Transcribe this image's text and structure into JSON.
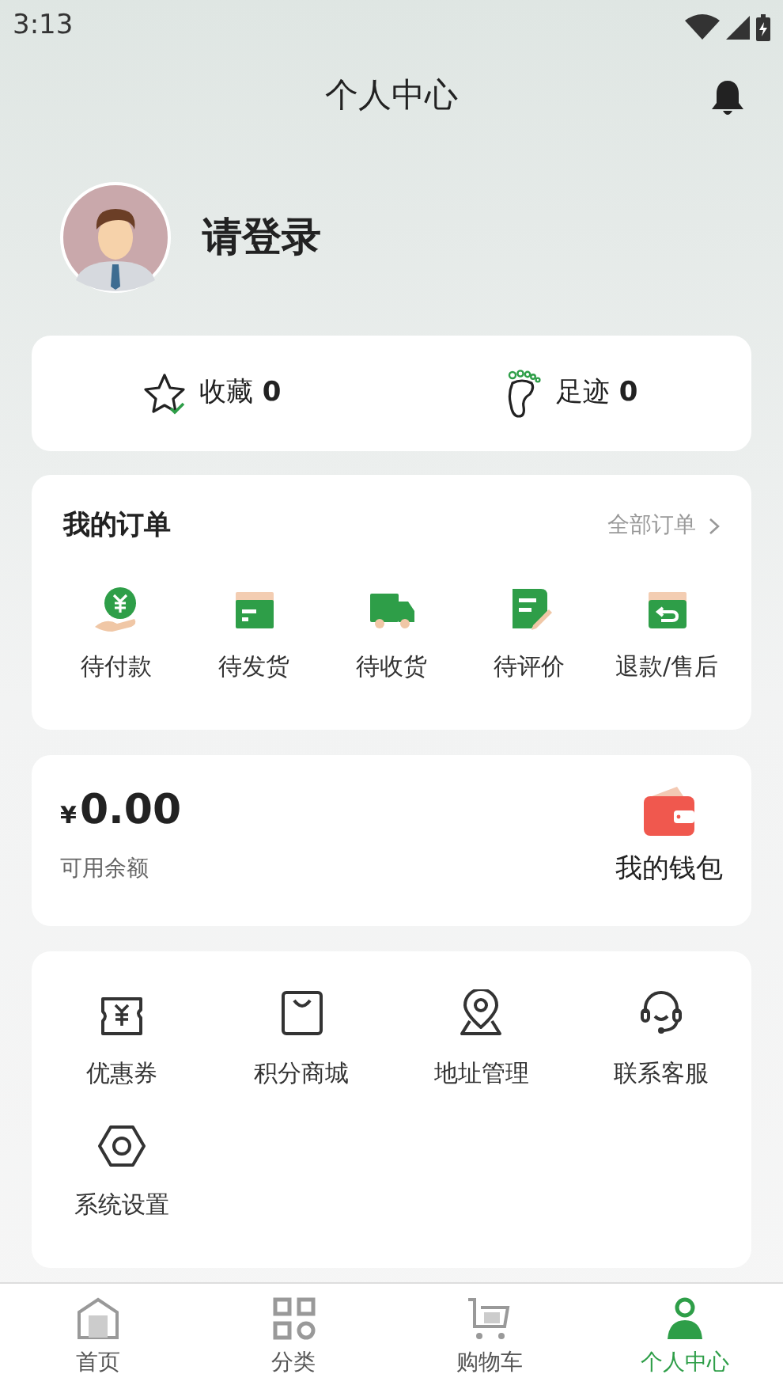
{
  "status_bar": {
    "time": "3:13"
  },
  "header": {
    "title": "个人中心"
  },
  "profile": {
    "login_text": "请登录"
  },
  "stats": [
    {
      "kind": "favorites",
      "label": "收藏",
      "count": "0"
    },
    {
      "kind": "footprints",
      "label": "足迹",
      "count": "0"
    }
  ],
  "orders": {
    "title": "我的订单",
    "all_link": "全部订单",
    "items": [
      {
        "kind": "pay",
        "label": "待付款"
      },
      {
        "kind": "ship",
        "label": "待发货"
      },
      {
        "kind": "receive",
        "label": "待收货"
      },
      {
        "kind": "review",
        "label": "待评价"
      },
      {
        "kind": "refund",
        "label": "退款/售后"
      }
    ]
  },
  "wallet": {
    "currency": "¥",
    "amount": "0.00",
    "balance_label": "可用余额",
    "wallet_label": "我的钱包"
  },
  "services": [
    {
      "kind": "coupon",
      "label": "优惠券"
    },
    {
      "kind": "mall",
      "label": "积分商城"
    },
    {
      "kind": "address",
      "label": "地址管理"
    },
    {
      "kind": "support",
      "label": "联系客服"
    },
    {
      "kind": "settings",
      "label": "系统设置"
    }
  ],
  "tab_bar": [
    {
      "kind": "home",
      "label": "首页",
      "selected": false
    },
    {
      "kind": "category",
      "label": "分类",
      "selected": false
    },
    {
      "kind": "cart",
      "label": "购物车",
      "selected": false
    },
    {
      "kind": "profile",
      "label": "个人中心",
      "selected": true
    }
  ]
}
